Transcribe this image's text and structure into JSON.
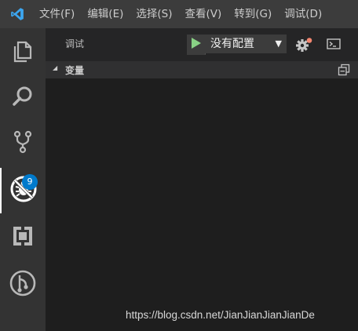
{
  "menubar": {
    "logo_icon": "vscode-logo-icon",
    "items": [
      {
        "label": "文件(F)"
      },
      {
        "label": "编辑(E)"
      },
      {
        "label": "选择(S)"
      },
      {
        "label": "查看(V)"
      },
      {
        "label": "转到(G)"
      },
      {
        "label": "调试(D)"
      }
    ]
  },
  "activitybar": {
    "items": [
      {
        "icon": "files-icon",
        "active": false
      },
      {
        "icon": "search-icon",
        "active": false
      },
      {
        "icon": "source-control-icon",
        "active": false,
        "badge": "9"
      },
      {
        "icon": "debug-icon",
        "active": true
      },
      {
        "icon": "extensions-icon",
        "active": false
      },
      {
        "icon": "git-graph-icon",
        "active": false
      }
    ]
  },
  "debug_panel": {
    "title": "调试",
    "play_icon": "play-icon",
    "config_selected": "没有配置",
    "gear_icon": "gear-icon",
    "console_icon": "debug-console-icon",
    "sections": [
      {
        "title": "变量",
        "expanded": true,
        "collapse_icon": "collapse-all-icon"
      }
    ]
  },
  "watermark": "https://blog.csdn.net/JianJianJianJianDe",
  "colors": {
    "accent": "#007acc",
    "play_green": "#89d185",
    "gear_dot": "#f48771"
  }
}
